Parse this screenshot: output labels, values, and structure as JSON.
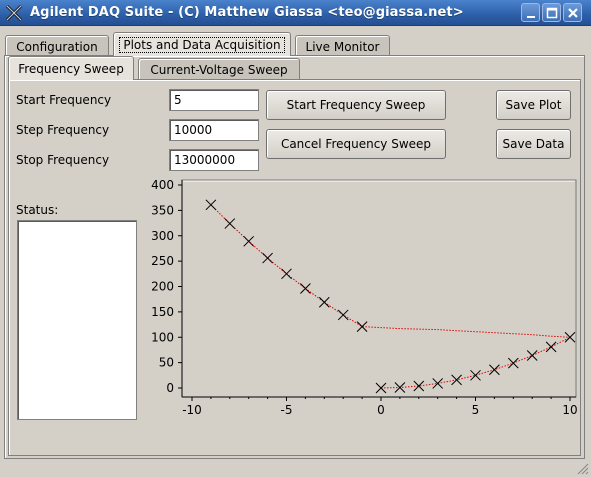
{
  "window": {
    "title": "Agilent DAQ Suite - (C) Matthew Giassa <teo@giassa.net>",
    "buttons": [
      "minimize",
      "maximize",
      "close"
    ]
  },
  "main_tabs": [
    {
      "label": "Configuration",
      "mnemonic": "u",
      "selected": false
    },
    {
      "label": "Plots and Data Acquisition",
      "mnemonic": "a",
      "selected": true
    },
    {
      "label": "Live Monitor",
      "mnemonic": "o",
      "selected": false
    }
  ],
  "sub_tabs": [
    {
      "label": "Frequency Sweep",
      "mnemonic": "q",
      "selected": true
    },
    {
      "label": "Current-Voltage Sweep",
      "selected": false
    }
  ],
  "form": {
    "start_label": "Start Frequency",
    "start_value": "5",
    "step_label": "Step Frequency",
    "step_value": "10000",
    "stop_label": "Stop Frequency",
    "stop_value": "13000000",
    "status_label": "Status:"
  },
  "buttons": {
    "start_sweep": "Start Frequency Sweep",
    "cancel_sweep": "Cancel Frequency Sweep",
    "save_plot": "Save Plot",
    "save_data": "Save Data"
  },
  "colors": {
    "title_bar": "#2c5fa8",
    "curve": "#e00000",
    "marker": "#000000",
    "plot_background": "#d4d0c8"
  },
  "icons": {
    "app": "x-cross-icon",
    "minimize": "minimize-icon",
    "maximize": "maximize-icon",
    "close": "close-icon"
  },
  "chart_data": {
    "type": "scatter",
    "title": "",
    "xlabel": "",
    "ylabel": "",
    "xlim": [
      -10,
      10
    ],
    "ylim": [
      0,
      400
    ],
    "x_ticks": [
      -10,
      -5,
      0,
      5,
      10
    ],
    "y_ticks": [
      0,
      50,
      100,
      150,
      200,
      250,
      300,
      350,
      400
    ],
    "grid": false,
    "legend": "none",
    "series": [
      {
        "style": "marker-x",
        "x": [
          -9,
          -8,
          -7,
          -6,
          -5,
          -4,
          -3,
          -2,
          -1,
          0,
          1,
          2,
          3,
          4,
          5,
          6,
          7,
          8,
          9,
          10
        ],
        "y": [
          361,
          324,
          289,
          256,
          225,
          196,
          169,
          144,
          121,
          0,
          1,
          4,
          9,
          16,
          25,
          36,
          49,
          64,
          81,
          100
        ]
      },
      {
        "style": "dotted-line",
        "x": [
          -9,
          -8,
          -7,
          -6,
          -5,
          -4,
          -3,
          -2,
          -1,
          0,
          1,
          2,
          3,
          4,
          5,
          6,
          7,
          8,
          9,
          10
        ],
        "y": [
          361,
          324,
          289,
          256,
          225,
          196,
          169,
          144,
          121,
          119,
          117,
          116,
          115,
          113,
          111,
          109,
          107,
          105,
          102,
          100
        ]
      },
      {
        "style": "dotted-line",
        "x": [
          0,
          1,
          2,
          3,
          4,
          5,
          6,
          7,
          8,
          9,
          10
        ],
        "y": [
          0,
          1,
          4,
          9,
          16,
          25,
          36,
          49,
          64,
          81,
          100
        ]
      }
    ]
  }
}
